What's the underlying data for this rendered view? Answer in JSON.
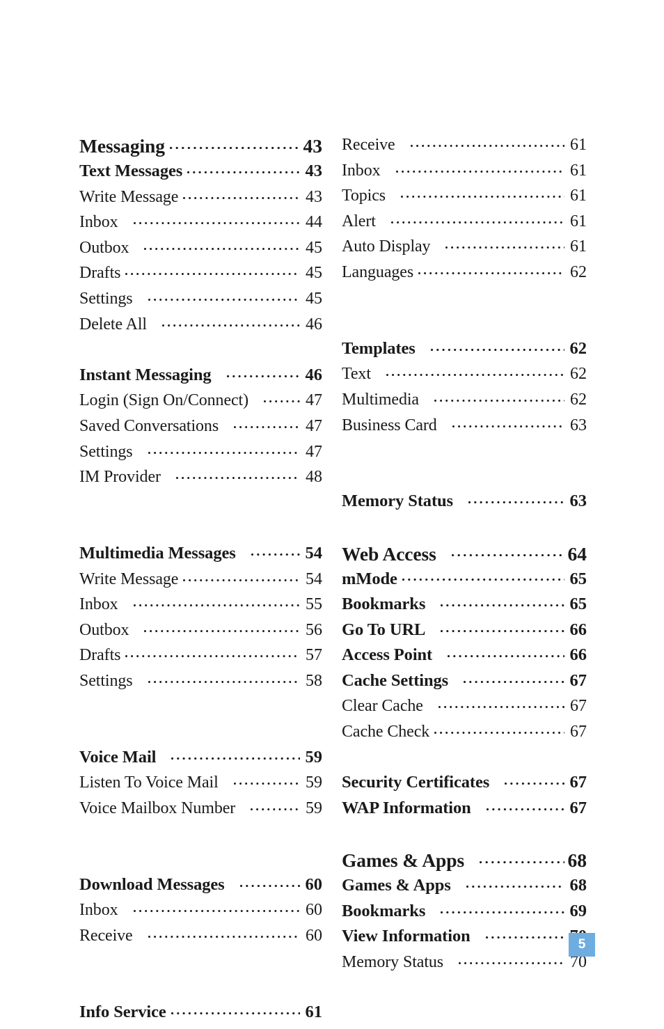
{
  "page": {
    "number": "5",
    "badge_color": "#6fade0",
    "text_color": "#1a1a1a",
    "background_color": "#ffffff"
  },
  "columns": {
    "left": [
      {
        "kind": "entry",
        "level": "chapter",
        "title": "Messaging",
        "page": "43"
      },
      {
        "kind": "entry",
        "level": "section",
        "title": "Text Messages",
        "page": "43"
      },
      {
        "kind": "entry",
        "level": "item",
        "title": "Write Message",
        "page": "43"
      },
      {
        "kind": "entry",
        "level": "item",
        "title": "Inbox",
        "page": "44",
        "gap": true
      },
      {
        "kind": "entry",
        "level": "item",
        "title": "Outbox",
        "page": "45",
        "gap": true
      },
      {
        "kind": "entry",
        "level": "item",
        "title": "Drafts",
        "page": "45"
      },
      {
        "kind": "entry",
        "level": "item",
        "title": "Settings",
        "page": "45",
        "gap": true
      },
      {
        "kind": "entry",
        "level": "item",
        "title": "Delete All",
        "page": "46",
        "gap": true
      },
      {
        "kind": "spacer"
      },
      {
        "kind": "entry",
        "level": "section",
        "title": "Instant Messaging",
        "page": "46",
        "gap": true
      },
      {
        "kind": "entry",
        "level": "item",
        "title": "Login (Sign On/Connect)",
        "page": "47",
        "gap": true
      },
      {
        "kind": "entry",
        "level": "item",
        "title": "Saved Conversations",
        "page": "47",
        "gap": true
      },
      {
        "kind": "entry",
        "level": "item",
        "title": "Settings",
        "page": "47",
        "gap": true
      },
      {
        "kind": "entry",
        "level": "item",
        "title": "IM Provider",
        "page": "48",
        "gap": true
      },
      {
        "kind": "spacer"
      },
      {
        "kind": "spacer"
      },
      {
        "kind": "entry",
        "level": "section",
        "title": "Multimedia Messages",
        "page": "54",
        "gap": true
      },
      {
        "kind": "entry",
        "level": "item",
        "title": "Write Message",
        "page": "54"
      },
      {
        "kind": "entry",
        "level": "item",
        "title": "Inbox",
        "page": "55",
        "gap": true
      },
      {
        "kind": "entry",
        "level": "item",
        "title": "Outbox",
        "page": "56",
        "gap": true
      },
      {
        "kind": "entry",
        "level": "item",
        "title": "Drafts",
        "page": "57"
      },
      {
        "kind": "entry",
        "level": "item",
        "title": "Settings",
        "page": "58",
        "gap": true
      },
      {
        "kind": "spacer"
      },
      {
        "kind": "spacer"
      },
      {
        "kind": "entry",
        "level": "section",
        "title": "Voice Mail",
        "page": "59",
        "gap": true
      },
      {
        "kind": "entry",
        "level": "item",
        "title": "Listen To Voice Mail",
        "page": "59",
        "gap": true
      },
      {
        "kind": "entry",
        "level": "item",
        "title": "Voice Mailbox Number",
        "page": "59",
        "gap": true
      },
      {
        "kind": "spacer"
      },
      {
        "kind": "spacer"
      },
      {
        "kind": "entry",
        "level": "section",
        "title": "Download Messages",
        "page": "60",
        "gap": true
      },
      {
        "kind": "entry",
        "level": "item",
        "title": "Inbox",
        "page": "60",
        "gap": true
      },
      {
        "kind": "entry",
        "level": "item",
        "title": "Receive",
        "page": "60",
        "gap": true
      },
      {
        "kind": "spacer"
      },
      {
        "kind": "spacer"
      },
      {
        "kind": "entry",
        "level": "section",
        "title": "Info Service",
        "page": "61"
      }
    ],
    "right": [
      {
        "kind": "entry",
        "level": "item",
        "title": "Receive",
        "page": "61",
        "gap": true
      },
      {
        "kind": "entry",
        "level": "item",
        "title": "Inbox",
        "page": "61",
        "gap": true
      },
      {
        "kind": "entry",
        "level": "item",
        "title": "Topics",
        "page": "61",
        "gap": true
      },
      {
        "kind": "entry",
        "level": "item",
        "title": "Alert",
        "page": "61",
        "gap": true
      },
      {
        "kind": "entry",
        "level": "item",
        "title": "Auto Display",
        "page": "61",
        "gap": true
      },
      {
        "kind": "entry",
        "level": "item",
        "title": "Languages",
        "page": "62"
      },
      {
        "kind": "spacer"
      },
      {
        "kind": "spacer"
      },
      {
        "kind": "entry",
        "level": "section",
        "title": "Templates",
        "page": "62",
        "gap": true
      },
      {
        "kind": "entry",
        "level": "item",
        "title": "Text",
        "page": "62",
        "gap": true
      },
      {
        "kind": "entry",
        "level": "item",
        "title": "Multimedia",
        "page": "62",
        "gap": true
      },
      {
        "kind": "entry",
        "level": "item",
        "title": "Business Card",
        "page": "63",
        "gap": true
      },
      {
        "kind": "spacer"
      },
      {
        "kind": "spacer"
      },
      {
        "kind": "entry",
        "level": "section",
        "title": "Memory Status",
        "page": "63",
        "gap": true
      },
      {
        "kind": "spacer"
      },
      {
        "kind": "entry",
        "level": "chapter",
        "title": "Web Access",
        "page": "64",
        "gap": true
      },
      {
        "kind": "entry",
        "level": "section",
        "title": "mMode",
        "page": "65"
      },
      {
        "kind": "entry",
        "level": "section",
        "title": "Bookmarks",
        "page": "65",
        "gap": true
      },
      {
        "kind": "entry",
        "level": "section",
        "title": "Go To URL",
        "page": "66",
        "gap": true
      },
      {
        "kind": "entry",
        "level": "section",
        "title": "Access Point",
        "page": "66",
        "gap": true
      },
      {
        "kind": "entry",
        "level": "section",
        "title": "Cache Settings",
        "page": "67",
        "gap": true
      },
      {
        "kind": "entry",
        "level": "item",
        "title": "Clear Cache",
        "page": "67",
        "gap": true
      },
      {
        "kind": "entry",
        "level": "item",
        "title": "Cache Check",
        "page": "67"
      },
      {
        "kind": "spacer"
      },
      {
        "kind": "entry",
        "level": "section",
        "title": "Security Certificates",
        "page": "67",
        "gap": true
      },
      {
        "kind": "entry",
        "level": "section",
        "title": "WAP Information",
        "page": "67",
        "gap": true
      },
      {
        "kind": "spacer"
      },
      {
        "kind": "entry",
        "level": "chapter",
        "title": "Games & Apps",
        "page": "68",
        "gap": true
      },
      {
        "kind": "entry",
        "level": "section",
        "title": "Games & Apps",
        "page": "68",
        "gap": true
      },
      {
        "kind": "entry",
        "level": "section",
        "title": "Bookmarks",
        "page": "69",
        "gap": true
      },
      {
        "kind": "entry",
        "level": "section",
        "title": "View Information",
        "page": "70",
        "gap": true
      },
      {
        "kind": "entry",
        "level": "item",
        "title": "Memory Status",
        "page": "70",
        "gap": true
      }
    ]
  }
}
